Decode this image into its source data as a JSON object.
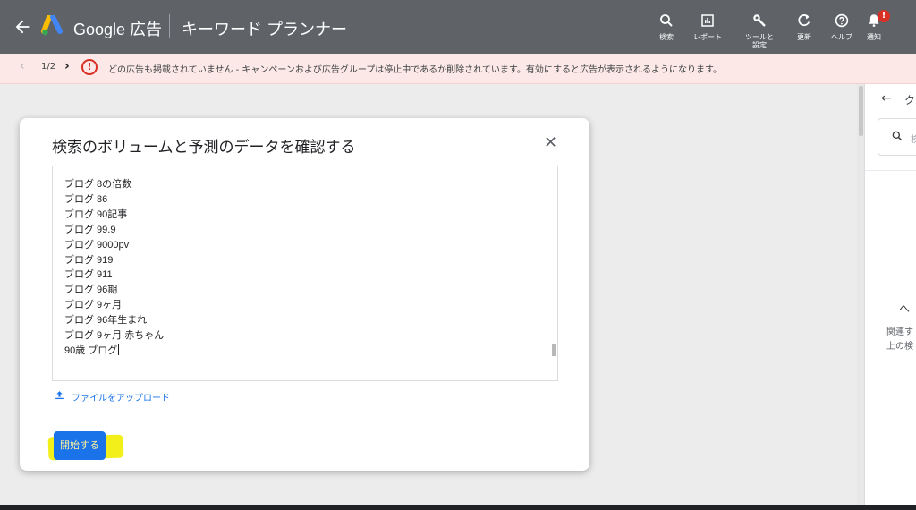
{
  "header": {
    "brand": "Google 広告",
    "title": "キーワード プランナー",
    "tools": [
      {
        "label": "検索",
        "icon": "search-icon"
      },
      {
        "label": "レポート",
        "icon": "report-icon"
      },
      {
        "label": "ツールと設定",
        "icon": "wrench-icon"
      },
      {
        "label": "更新",
        "icon": "refresh-icon"
      },
      {
        "label": "ヘルプ",
        "icon": "help-icon"
      },
      {
        "label": "通知",
        "icon": "bell-icon"
      }
    ],
    "notification_badge": "!"
  },
  "alert": {
    "counter": "1/2",
    "icon_text": "!",
    "message": "どの広告も掲載されていません - キャンペーンおよび広告グループは停止中であるか削除されています。有効にすると広告が表示されるようになります。"
  },
  "dialog": {
    "title": "検索のボリュームと予測のデータを確認する",
    "keywords": [
      "ブログ 8の倍数",
      "ブログ 86",
      "ブログ 90記事",
      "ブログ 99.9",
      "ブログ 9000pv",
      "ブログ 919",
      "ブログ 911",
      "ブログ 96期",
      "ブログ 9ヶ月",
      "ブログ 96年生まれ",
      "ブログ 9ヶ月 赤ちゃん",
      "90歳 ブログ"
    ],
    "upload_label": "ファイルをアップロード",
    "start_button": "開始する"
  },
  "right_panel": {
    "title": "ク",
    "search_placeholder": "検",
    "heading": "へ",
    "text_line1": "関連す",
    "text_line2": "上の検"
  },
  "colors": {
    "header_bg": "#5f6368",
    "alert_bg": "#fce8e6",
    "accent": "#1a73e8",
    "highlight": "#f3ef1a",
    "error": "#d93025"
  }
}
